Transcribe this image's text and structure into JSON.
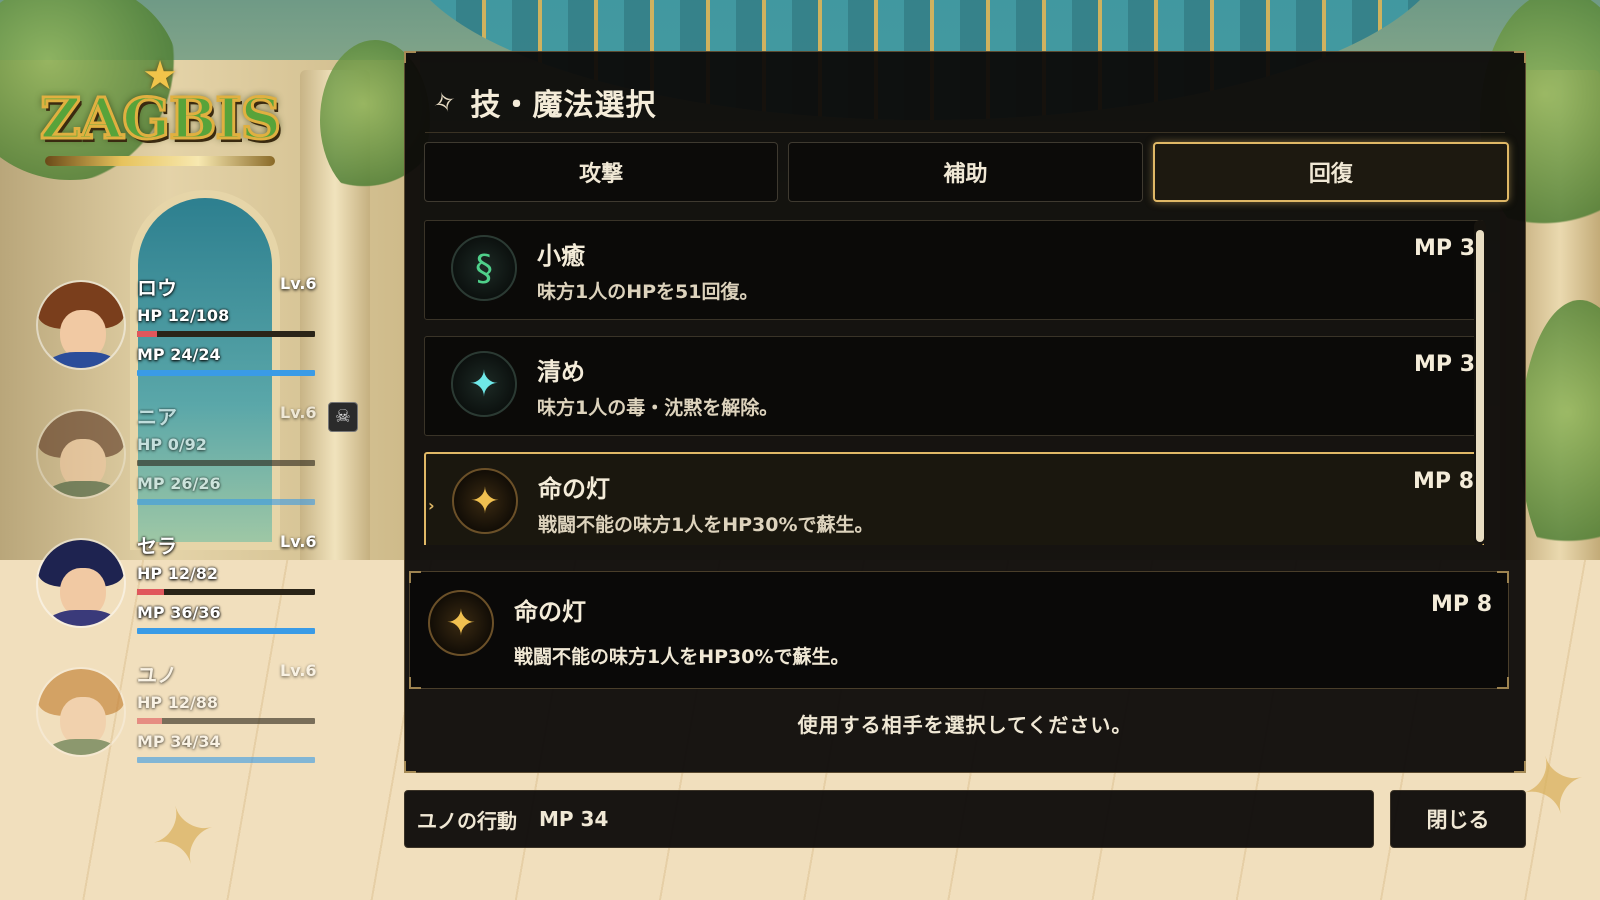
{
  "game": {
    "logo_text": "ZAGBIS"
  },
  "party": [
    {
      "name": "ロウ",
      "level": "Lv.6",
      "hp_text": "HP 12/108",
      "mp_text": "MP 24/24",
      "hp_ratio": 0.11,
      "mp_ratio": 1.0,
      "hair_color": "#7a3e1c",
      "body_color": "#2b4d9a"
    },
    {
      "name": "ニア",
      "level": "Lv.6",
      "hp_text": "HP 0/92",
      "mp_text": "MP 26/26",
      "hp_ratio": 0.0,
      "mp_ratio": 1.0,
      "hair_color": "#5a3520",
      "body_color": "#3d5a3a",
      "status_icon": "skull-icon",
      "status_glyph": "☠"
    },
    {
      "name": "セラ",
      "level": "Lv.6",
      "hp_text": "HP 12/82",
      "mp_text": "MP 36/36",
      "hp_ratio": 0.15,
      "mp_ratio": 1.0,
      "hair_color": "#1e2350",
      "body_color": "#3a3a7a"
    },
    {
      "name": "ユノ",
      "level": "Lv.6",
      "hp_text": "HP 12/88",
      "mp_text": "MP 34/34",
      "hp_ratio": 0.14,
      "mp_ratio": 1.0,
      "hair_color": "#c07a2a",
      "body_color": "#4a6a3a"
    }
  ],
  "panel": {
    "title": "技・魔法選択",
    "title_icon": "wand-icon",
    "tabs": [
      {
        "label": "攻撃",
        "active": false
      },
      {
        "label": "補助",
        "active": false
      },
      {
        "label": "回復",
        "active": true
      }
    ],
    "skills": [
      {
        "name": "小癒",
        "desc": "味方1人のHPを51回復。",
        "cost": "MP 3",
        "icon": "green-spiral-icon",
        "glyph": "§",
        "tone": "green",
        "selected": false
      },
      {
        "name": "清め",
        "desc": "味方1人の毒・沈黙を解除。",
        "cost": "MP 3",
        "icon": "sparkle-icon",
        "glyph": "✦",
        "tone": "cyan",
        "selected": false
      },
      {
        "name": "命の灯",
        "desc": "戦闘不能の味方1人をHP30%で蘇生。",
        "cost": "MP 8",
        "icon": "life-star-icon",
        "glyph": "✦",
        "tone": "gold",
        "selected": true
      }
    ],
    "detail": {
      "name": "命の灯",
      "desc": "戦闘不能の味方1人をHP30%で蘇生。",
      "cost": "MP 8",
      "icon": "life-star-icon",
      "glyph": "✦"
    },
    "prompt": "使用する相手を選択してください。"
  },
  "action_bar": {
    "actor": "ユノの行動",
    "mp": "MP 34"
  },
  "close_label": "閉じる",
  "colors": {
    "accent": "#e0b866",
    "hp": "#e0575c",
    "mp": "#3a9be6",
    "panel_bg": "#0c0a08"
  }
}
